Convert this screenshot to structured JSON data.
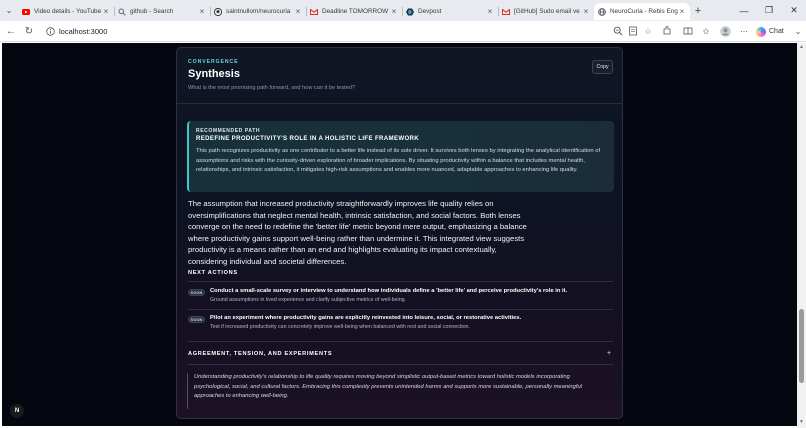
{
  "browser": {
    "tabs": [
      {
        "title": "Video details - YouTube",
        "icon": "youtube-icon",
        "active": false
      },
      {
        "title": "github - Search",
        "icon": "search-icon",
        "active": false
      },
      {
        "title": "saintnullom/neurocuria",
        "icon": "github-icon",
        "active": false
      },
      {
        "title": "Deadline TOMORROW",
        "icon": "gmail-icon",
        "active": false
      },
      {
        "title": "Devpost",
        "icon": "devpost-icon",
        "active": false
      },
      {
        "title": "[GitHub] Sudo email ve",
        "icon": "gmail-icon",
        "active": false
      },
      {
        "title": "NeuroCuria - Rebis Engi",
        "icon": "globe-icon",
        "active": true
      }
    ],
    "url": "localhost:3000",
    "chat_label": "Chat",
    "accent": "#1a73e8"
  },
  "card": {
    "eyebrow": "CONVERGENCE",
    "title": "Synthesis",
    "subtitle": "What is the most promising path forward, and how can it be tested?",
    "copy_label": "Copy"
  },
  "recommended": {
    "eyebrow": "RECOMMENDED PATH",
    "title": "REDEFINE PRODUCTIVITY'S ROLE IN A HOLISTIC LIFE FRAMEWORK",
    "text": "This path recognizes productivity as one contributor to a better life instead of its sole driver. It survives both lenses by integrating the analytical identification of assumptions and risks with the curiosity-driven exploration of broader implications. By situating productivity within a balance that includes mental health, relationships, and intrinsic satisfaction, it mitigates high-risk assumptions and enables more nuanced, adaptable approaches to enhancing life quality."
  },
  "summary": "The assumption that increased productivity straightforwardly improves life quality relies on oversimplifications that neglect mental health, intrinsic satisfaction, and social factors. Both lenses converge on the need to redefine the 'better life' metric beyond mere output, emphasizing a balance where productivity gains support well-being rather than undermine it. This integrated view suggests productivity is a means rather than an end and highlights evaluating its impact contextually, considering individual and societal differences.",
  "next_actions": {
    "label": "NEXT ACTIONS",
    "items": [
      {
        "badge": "SOON",
        "title": "Conduct a small-scale survey or interview to understand how individuals define a 'better life' and perceive productivity's role in it.",
        "desc": "Ground assumptions in lived experience and clarify subjective metrics of well-being."
      },
      {
        "badge": "SOON",
        "title": "Pilot an experiment where productivity gains are explicitly reinvested into leisure, social, or restorative activities.",
        "desc": "Test if increased productivity can concretely improve well-being when balanced with rest and social connection."
      }
    ]
  },
  "agreement": {
    "label": "AGREEMENT, TENSION, AND EXPERIMENTS",
    "quote": "Understanding productivity's relationship to life quality requires moving beyond simplistic output-based metrics toward holistic models incorporating psychological, social, and cultural factors. Embracing this complexity prevents unintended harms and supports more sustainable, personally meaningful approaches to enhancing well-being."
  },
  "fab_label": "N"
}
